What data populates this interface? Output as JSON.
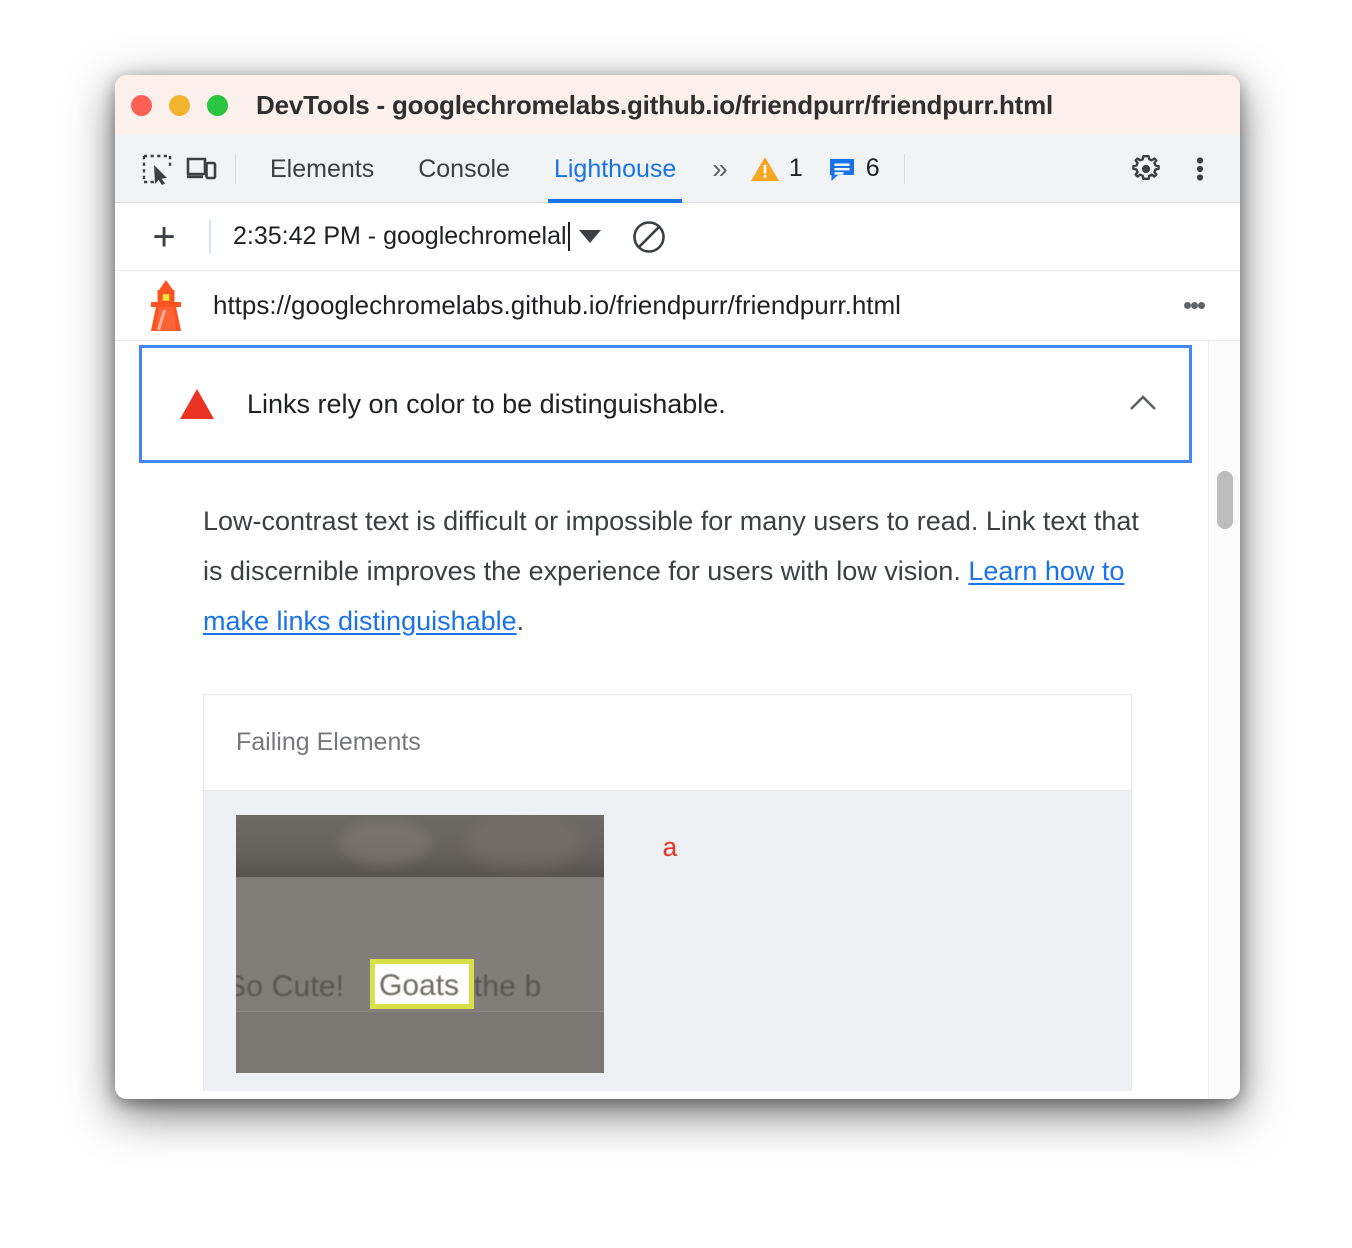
{
  "window": {
    "title": "DevTools - googlechromelabs.github.io/friendpurr/friendpurr.html",
    "traffic_lights": [
      "close",
      "minimize",
      "maximize"
    ]
  },
  "toolbar": {
    "inspect_icon": "inspect-element-icon",
    "device_icon": "device-toolbar-icon",
    "tabs": [
      {
        "label": "Elements",
        "active": false
      },
      {
        "label": "Console",
        "active": false
      },
      {
        "label": "Lighthouse",
        "active": true
      }
    ],
    "more_tabs_icon": "double-chevron-right-icon",
    "warnings": {
      "icon": "warning-triangle-icon",
      "count": "1"
    },
    "issues": {
      "icon": "issues-message-icon",
      "count": "6"
    },
    "settings_icon": "gear-icon",
    "menu_icon": "kebab-menu-icon"
  },
  "lighthouse_toolbar": {
    "add_label": "+",
    "report_name": "2:35:42 PM - googlechromelal",
    "dropdown_icon": "chevron-down-icon",
    "clear_icon": "no-entry-clear-icon"
  },
  "url_bar": {
    "brand_icon": "lighthouse-logo-icon",
    "url": "https://googlechromelabs.github.io/friendpurr/friendpurr.html",
    "menu_icon": "kebab-menu-icon"
  },
  "audit": {
    "status_icon": "fail-triangle-icon",
    "title": "Links rely on color to be distinguishable.",
    "collapse_icon": "chevron-up-icon",
    "description_before": "Low-contrast text is difficult or impossible for many users to read. Link text that is discernible improves the experience for users with low vision. ",
    "description_link": "Learn how to make links distinguishable",
    "description_after": "."
  },
  "failing_elements": {
    "header": "Failing Elements",
    "rows": [
      {
        "selector": "a",
        "screenshot": {
          "page_text_before": "So Cute! ",
          "page_text_highlight": "Goats",
          "page_text_after": " are the b",
          "highlight_color": "#d7e04a"
        }
      }
    ]
  },
  "colors": {
    "accent_blue": "#1a73e8",
    "focus_blue": "#4285f4",
    "fail_red": "#ea3323",
    "warning_orange": "#f5a623",
    "titlebar_bg": "#fbf0ec",
    "toolbar_bg": "#f1f3f4",
    "table_body_bg": "#eef0f4"
  },
  "scrollbar": {
    "name": "report-scrollbar"
  }
}
